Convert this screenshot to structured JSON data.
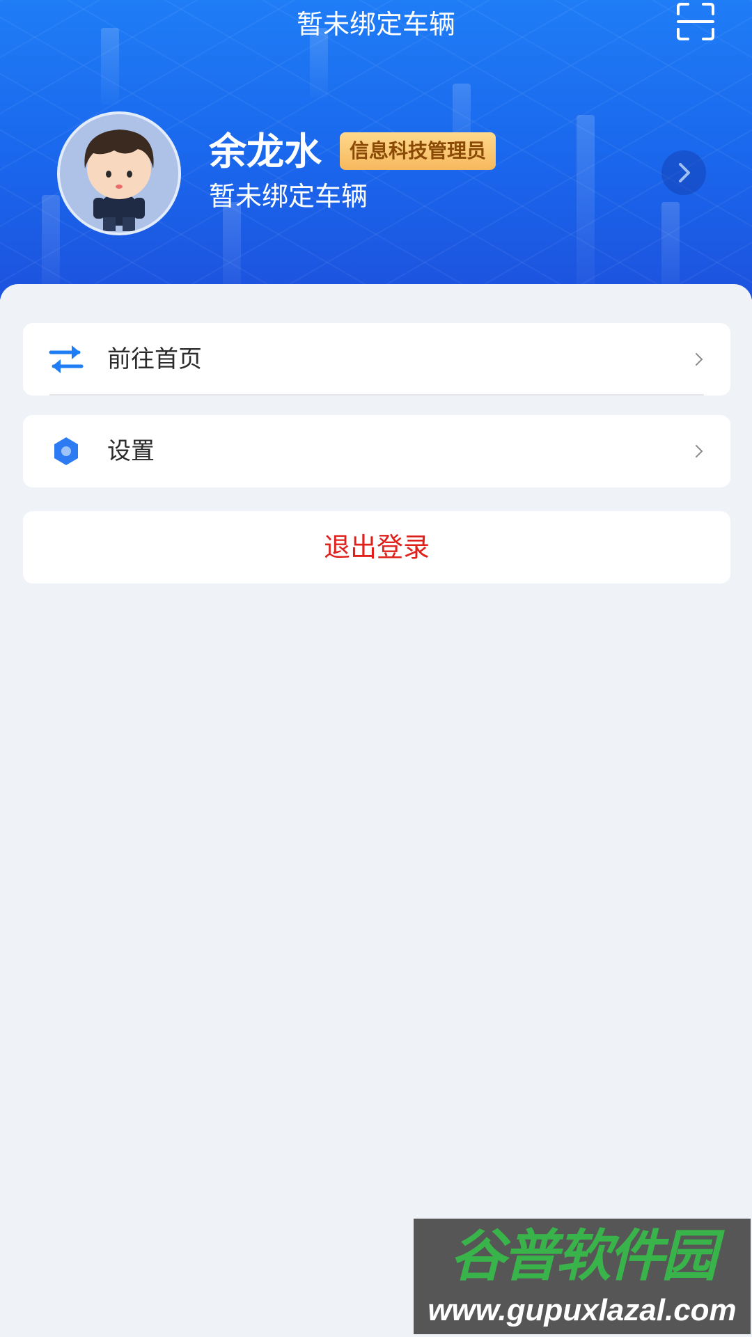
{
  "header": {
    "title": "暂未绑定车辆",
    "scan_icon": "scan-icon",
    "background_color": "#1a66ec"
  },
  "profile": {
    "name": "余龙水",
    "role": "信息科技管理员",
    "subtitle": "暂未绑定车辆",
    "avatar_icon": "cartoon-avatar",
    "arrow_icon": "chevron-right-icon"
  },
  "menu": {
    "items": [
      {
        "label": "前往首页",
        "icon": "swap-arrows-icon",
        "icon_color": "#1e7cf4"
      },
      {
        "label": "设置",
        "icon": "hexagon-settings-icon",
        "icon_color": "#2d7bf2"
      }
    ],
    "logout_label": "退出登录",
    "logout_color": "#e0201b"
  },
  "watermark": {
    "brand": "谷普软件园",
    "url": "www.gupuxlazal.com"
  }
}
